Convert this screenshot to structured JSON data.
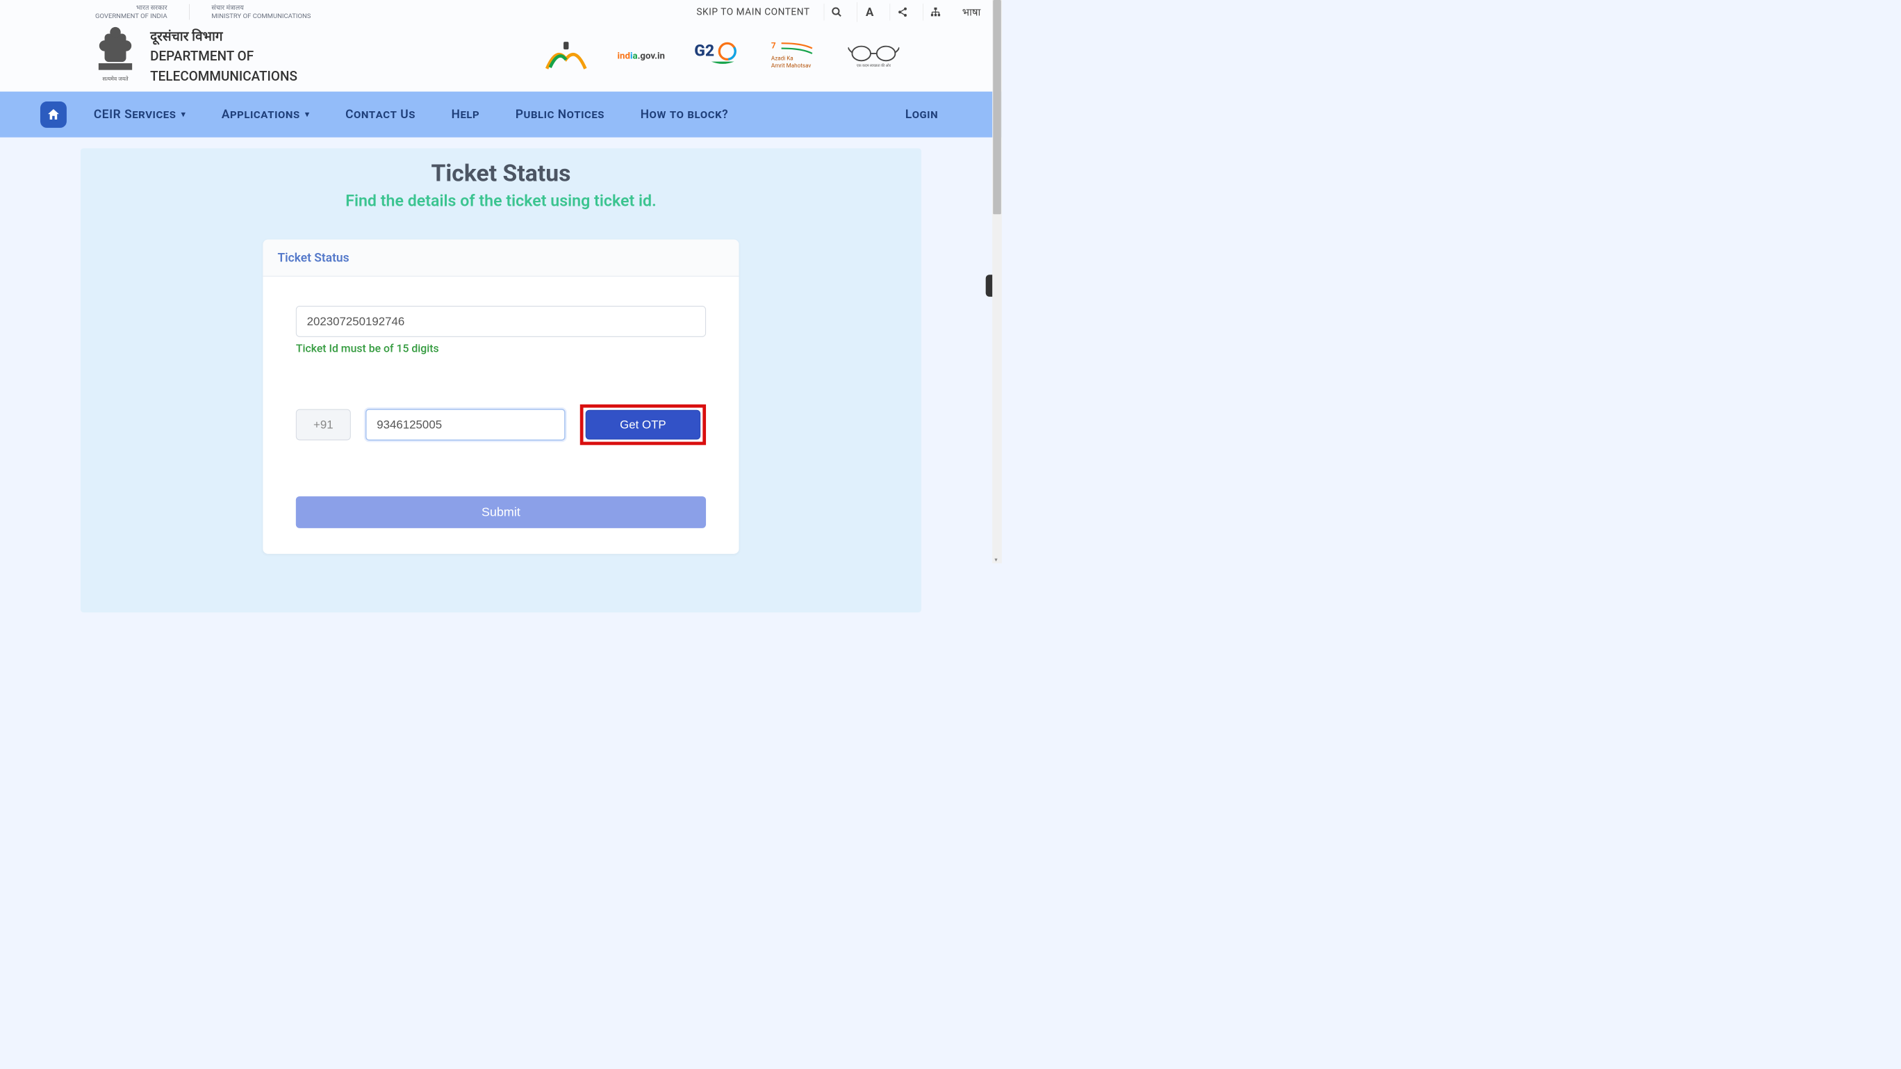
{
  "top_bar": {
    "gov_hindi": "भारत सरकार",
    "gov_eng": "GOVERNMENT OF INDIA",
    "ministry_hindi": "संचार मंत्रालय",
    "ministry_eng": "MINISTRY OF COMMUNICATIONS",
    "skip": "SKIP TO MAIN CONTENT",
    "font_label": "A",
    "lang_label": "भाषा"
  },
  "header": {
    "dept_hindi": "दूरसंचार विभाग",
    "dept_eng_1": "DEPARTMENT OF",
    "dept_eng_2": "TELECOMMUNICATIONS",
    "logos": [
      "sanchar-saathi",
      "india-gov-in",
      "g20",
      "azadi-amrit-mahotsav",
      "glasses-logo"
    ]
  },
  "nav": {
    "items": [
      {
        "label": "CEIR Services",
        "has_dropdown": true
      },
      {
        "label": "Applications",
        "has_dropdown": true
      },
      {
        "label": "Contact Us",
        "has_dropdown": false
      },
      {
        "label": "Help",
        "has_dropdown": false
      },
      {
        "label": "Public Notices",
        "has_dropdown": false
      },
      {
        "label": "How to block?",
        "has_dropdown": false
      }
    ],
    "login": "Login"
  },
  "page": {
    "title": "Ticket Status",
    "subtitle": "Find the details of the ticket using ticket id.",
    "card_title": "Ticket Status",
    "ticket_value": "202307250192746",
    "ticket_hint": "Ticket Id must be of 15 digits",
    "phone_prefix": "+91",
    "phone_value": "9346125005",
    "get_otp": "Get OTP",
    "submit": "Submit"
  }
}
